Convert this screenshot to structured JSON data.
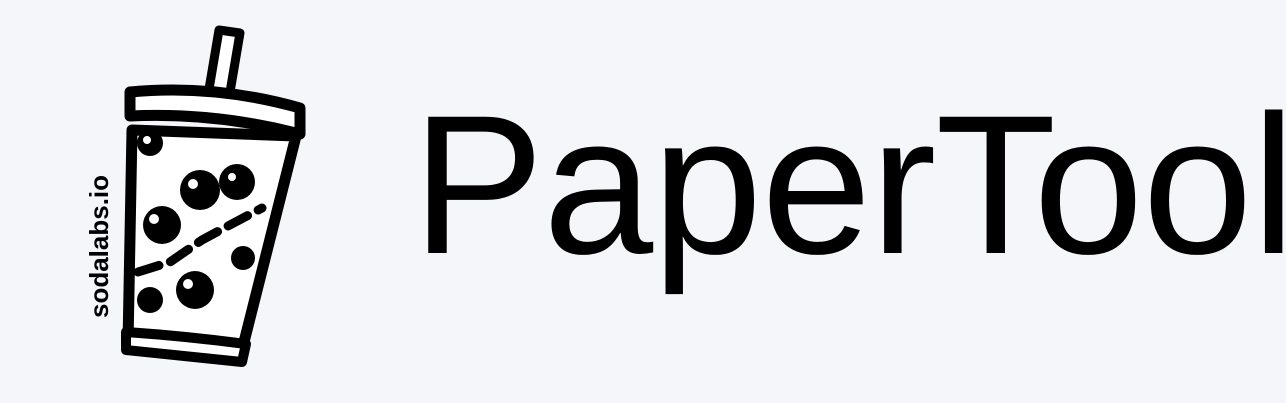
{
  "brand": {
    "title": "PaperTool",
    "logo_text": "sodalabs.io",
    "logo_icon": "boba-cup-icon"
  },
  "colors": {
    "background": "#f4f6fa",
    "ink": "#000000",
    "cup_fill": "#ffffff"
  }
}
